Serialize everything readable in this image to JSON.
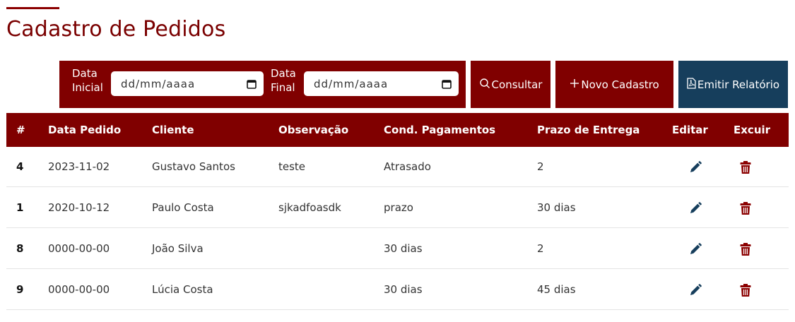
{
  "page": {
    "title": "Cadastro de Pedidos"
  },
  "filters": {
    "start_label_line1": "Data",
    "start_label_line2": "Inicial",
    "start_value": "dd/mm/aaaa",
    "end_label_line1": "Data",
    "end_label_line2": "Final",
    "end_value": "dd/mm/aaaa"
  },
  "actions": {
    "consultar": "Consultar",
    "novo": "Novo Cadastro",
    "relatorio": "Emitir Relatório"
  },
  "table": {
    "headers": [
      "#",
      "Data Pedido",
      "Cliente",
      "Observação",
      "Cond. Pagamentos",
      "Prazo de Entrega",
      "Editar",
      "Excuir"
    ],
    "rows": [
      {
        "id": "4",
        "date": "2023-11-02",
        "client": "Gustavo Santos",
        "obs": "teste",
        "payment": "Atrasado",
        "delivery": "2"
      },
      {
        "id": "1",
        "date": "2020-10-12",
        "client": "Paulo Costa",
        "obs": "sjkadfoasdk",
        "payment": "prazo",
        "delivery": "30 dias"
      },
      {
        "id": "8",
        "date": "0000-00-00",
        "client": "João Silva",
        "obs": "",
        "payment": "30 dias",
        "delivery": "2"
      },
      {
        "id": "9",
        "date": "0000-00-00",
        "client": "Lúcia Costa",
        "obs": "",
        "payment": "30 dias",
        "delivery": "45 dias"
      }
    ]
  },
  "colors": {
    "primary": "#800000",
    "secondary": "#163e5c",
    "edit_icon": "#163e5c",
    "delete_icon": "#8b0000"
  },
  "icons": {
    "consultar": "search-icon",
    "novo": "plus-icon",
    "relatorio": "pdf-file-icon",
    "edit": "pencil-icon",
    "delete": "trash-icon",
    "calendar": "calendar-icon"
  }
}
